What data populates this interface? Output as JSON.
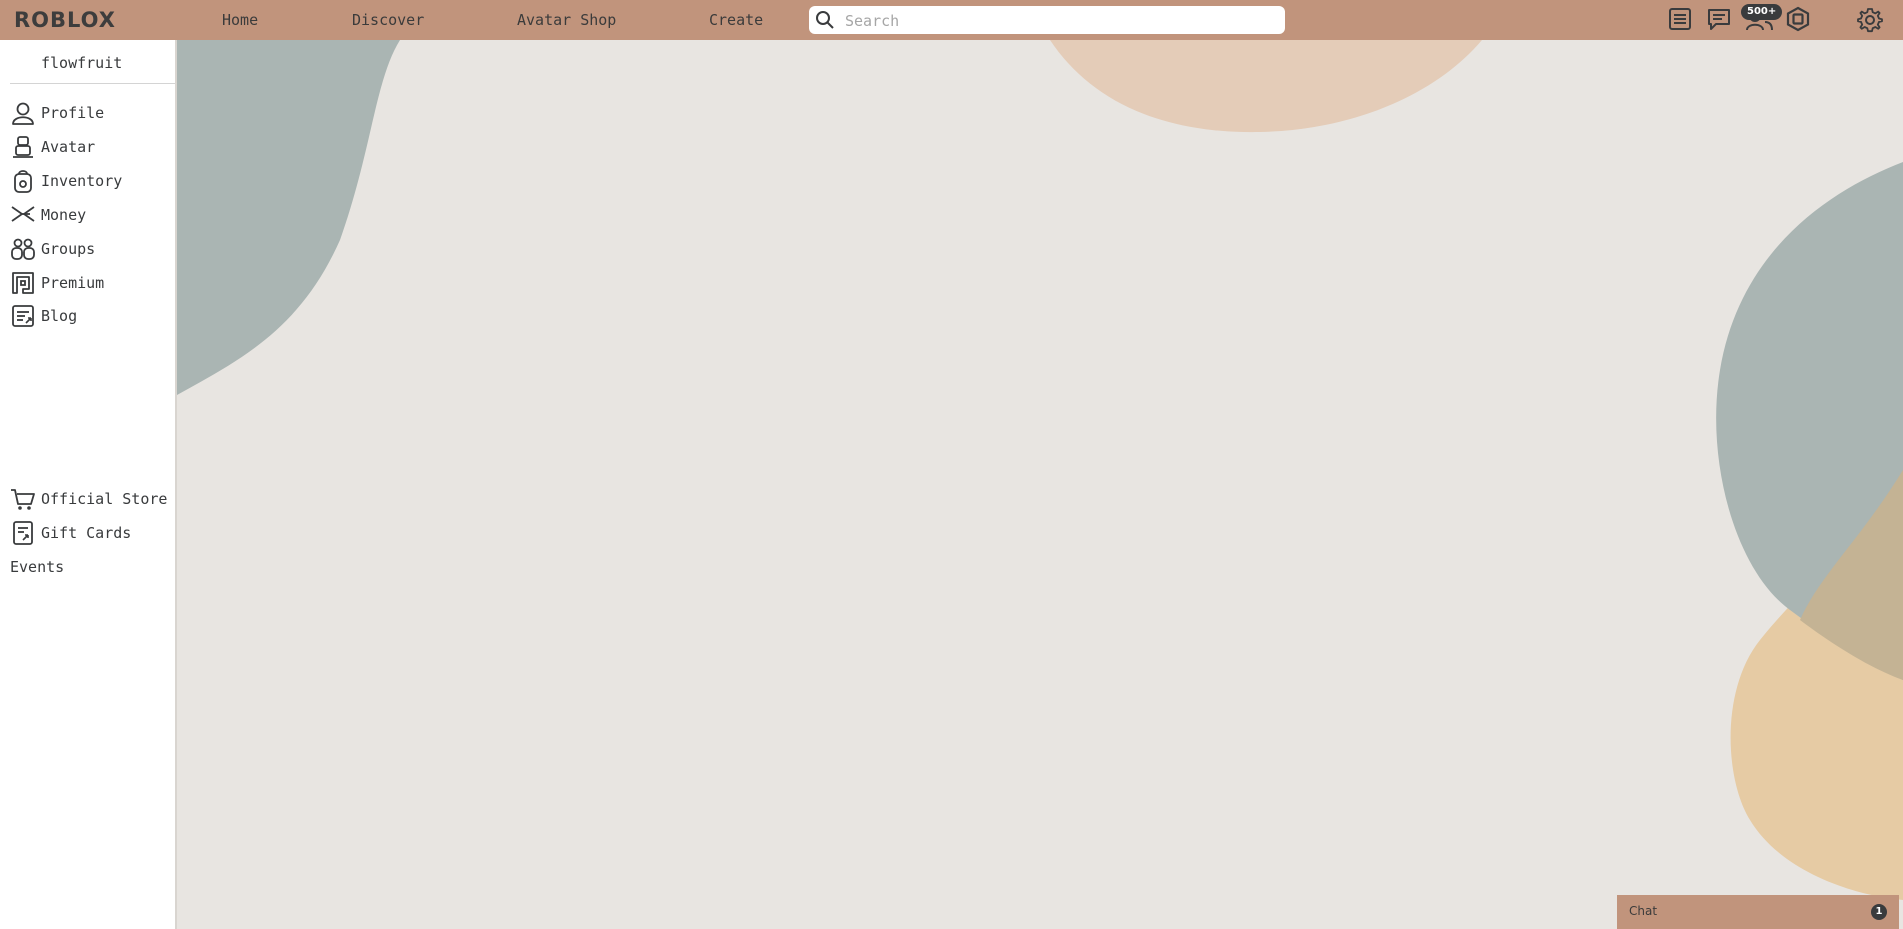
{
  "header": {
    "logo_text": "ROBLOX",
    "nav": [
      {
        "label": "Home"
      },
      {
        "label": "Discover"
      },
      {
        "label": "Avatar Shop"
      },
      {
        "label": "Create"
      }
    ],
    "search": {
      "placeholder": "Search",
      "value": ""
    },
    "icons": [
      "catalog-icon",
      "messages-icon",
      "friends-icon",
      "robux-icon",
      "settings-icon"
    ],
    "friends_badge": "500+"
  },
  "sidebar": {
    "username": "flowfruit",
    "items": [
      {
        "label": "Profile",
        "icon": "profile-icon"
      },
      {
        "label": "Avatar",
        "icon": "avatar-icon"
      },
      {
        "label": "Inventory",
        "icon": "inventory-icon"
      },
      {
        "label": "Money",
        "icon": "money-icon"
      },
      {
        "label": "Groups",
        "icon": "groups-icon"
      },
      {
        "label": "Premium",
        "icon": "premium-icon"
      },
      {
        "label": "Blog",
        "icon": "blog-icon"
      }
    ],
    "secondary_items": [
      {
        "label": "Official Store",
        "icon": "cart-icon"
      },
      {
        "label": "Gift Cards",
        "icon": "gift-card-icon"
      }
    ],
    "events_label": "Events"
  },
  "chat": {
    "label": "Chat",
    "unread": "1"
  },
  "colors": {
    "topbar": "#c1947c",
    "page_background": "#e8e5e1",
    "blob_gray": "#aab5b3",
    "blob_peach": "#e4ccb8",
    "blob_tan": "#e6cba4"
  }
}
